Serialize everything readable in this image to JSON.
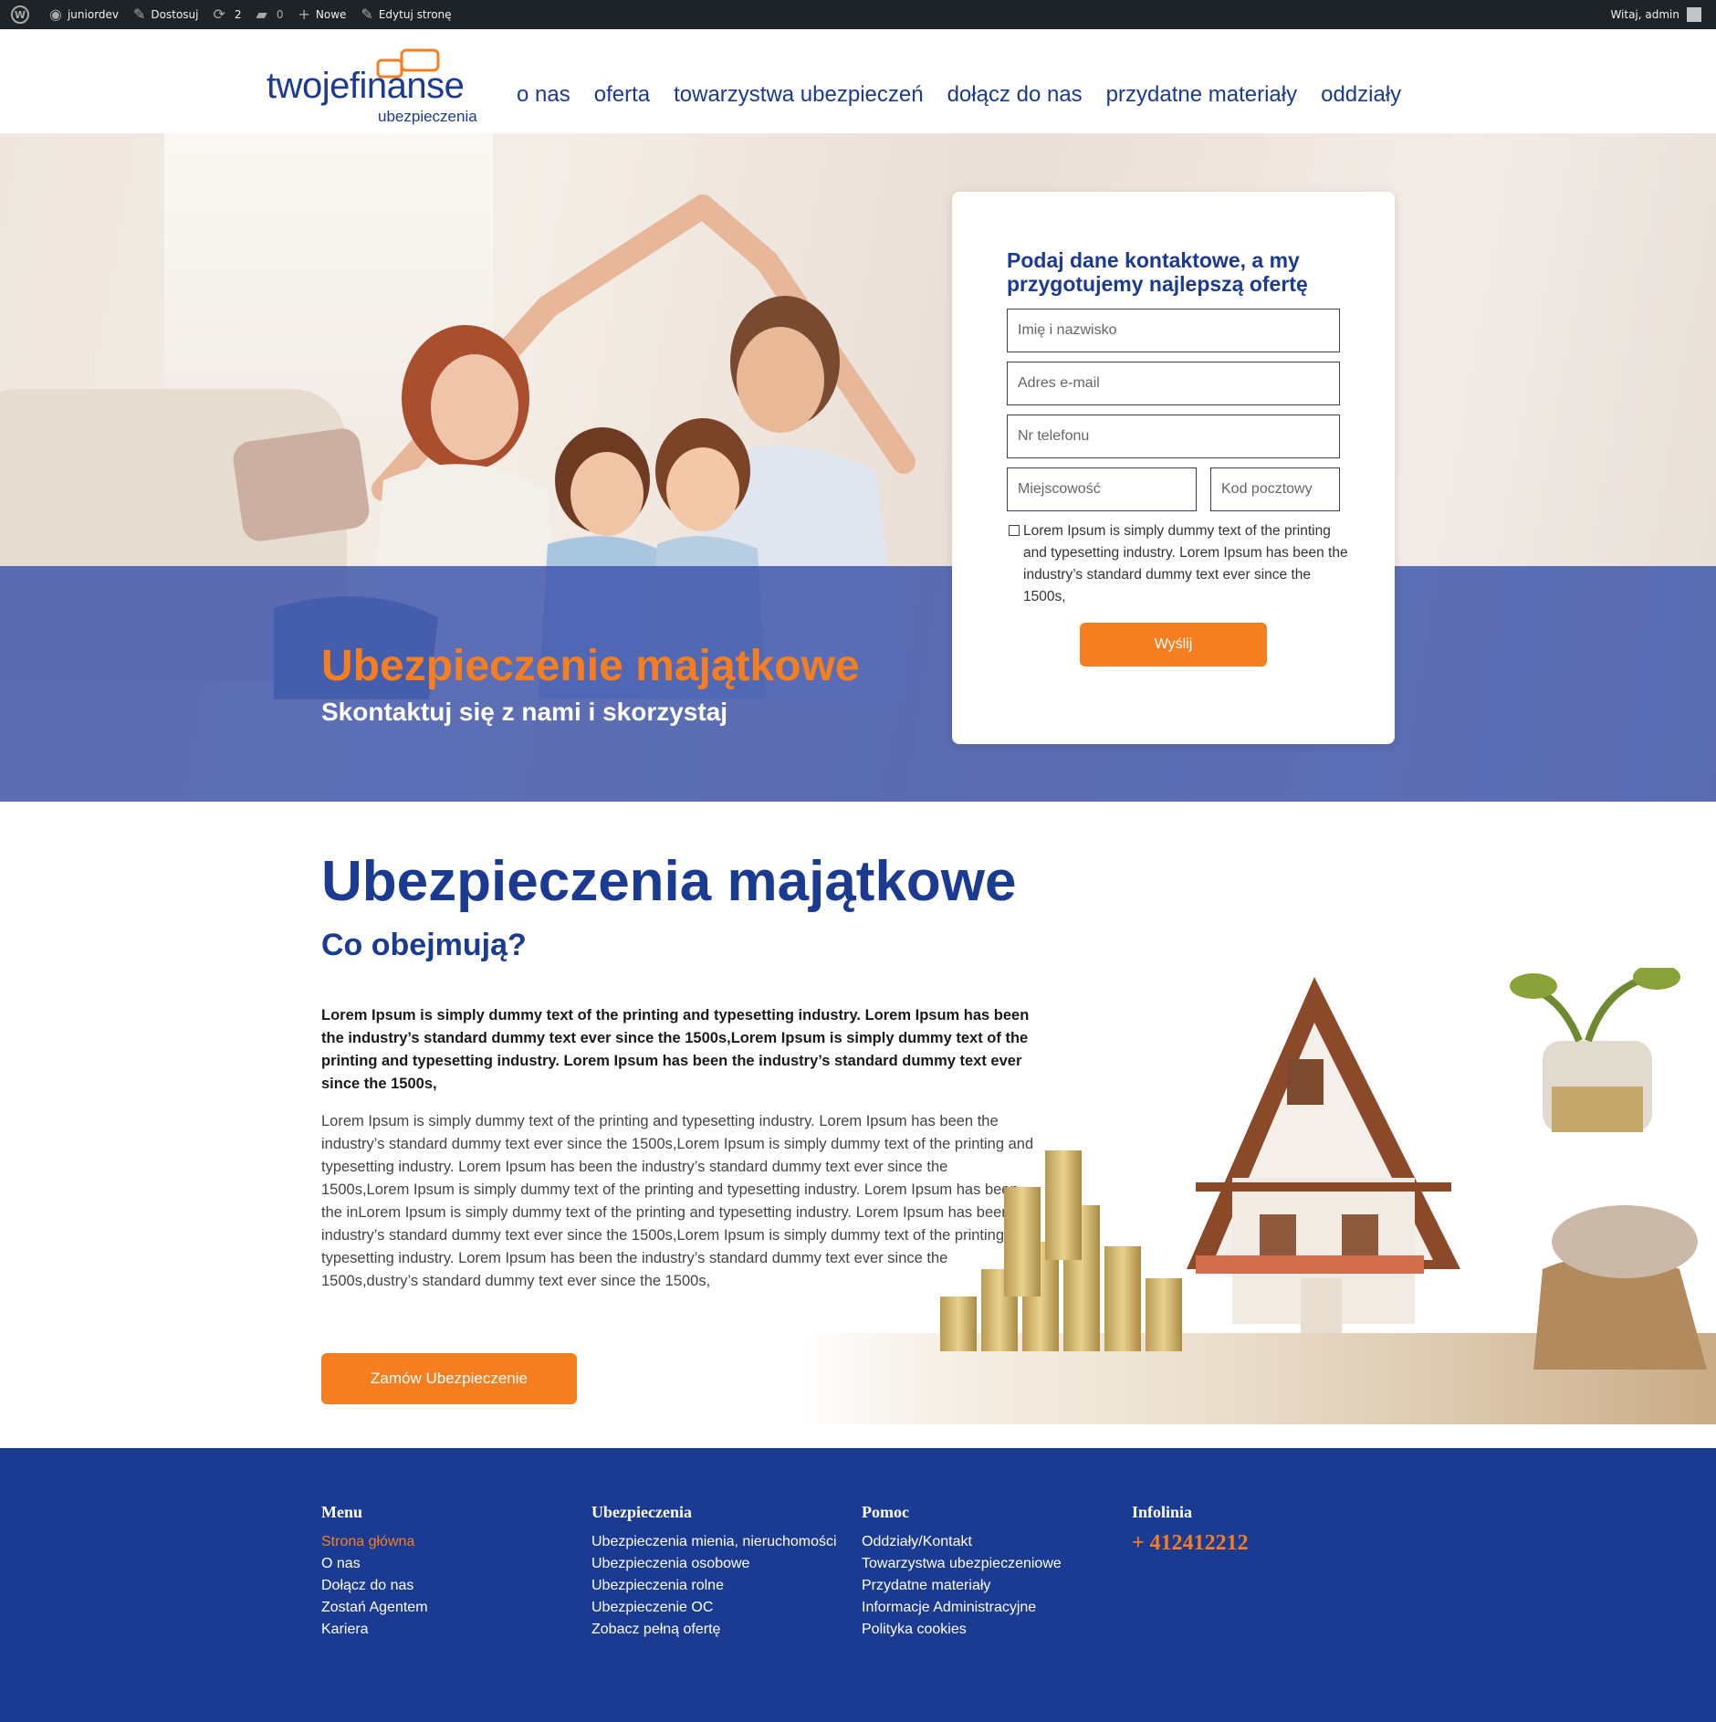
{
  "adminbar": {
    "site": "juniordev",
    "customize": "Dostosuj",
    "updates_count": "2",
    "comments_count": "0",
    "new": "Nowe",
    "edit": "Edytuj stronę",
    "greeting": "Witaj, admin"
  },
  "header": {
    "logo_main": "twojefinanse",
    "logo_sub": "ubezpieczenia",
    "nav": [
      "o nas",
      "oferta",
      "towarzystwa ubezpieczeń",
      "dołącz do nas",
      "przydatne materiały",
      "oddziały"
    ]
  },
  "hero": {
    "title": "Ubezpieczenie majątkowe",
    "subtitle": "Skontaktuj się z nami i skorzystaj"
  },
  "form": {
    "title": "Podaj dane kontaktowe, a my przygotujemy najlepszą ofertę",
    "name_placeholder": "Imię i nazwisko",
    "email_placeholder": "Adres e-mail",
    "phone_placeholder": "Nr telefonu",
    "city_placeholder": "Miejscowość",
    "zip_placeholder": "Kod pocztowy",
    "consent": "Lorem Ipsum is simply dummy text of the printing and typesetting industry. Lorem Ipsum has been the industry’s standard dummy text ever since the 1500s,",
    "submit": "Wyślij"
  },
  "content": {
    "title": "Ubezpieczenia majątkowe",
    "subtitle": "Co obejmują?",
    "lead": "Lorem Ipsum is simply dummy text of the printing and typesetting industry. Lorem Ipsum has been the industry’s standard dummy text ever since the 1500s,Lorem Ipsum is simply dummy text of the printing and typesetting industry. Lorem Ipsum has been the industry’s standard dummy text ever since the 1500s,",
    "body": "Lorem Ipsum is simply dummy text of the printing and typesetting industry. Lorem Ipsum has been the industry’s standard dummy text ever since the 1500s,Lorem Ipsum is simply dummy text of the printing and typesetting industry. Lorem Ipsum has been the industry’s standard dummy text ever since the 1500s,Lorem Ipsum is simply dummy text of the printing and typesetting industry. Lorem Ipsum has been the inLorem Ipsum is simply dummy text of the printing and typesetting industry. Lorem Ipsum has been the industry’s standard dummy text ever since the 1500s,Lorem Ipsum is simply dummy text of the printing and typesetting industry. Lorem Ipsum has been the industry’s standard dummy text ever since the 1500s,dustry’s standard dummy text ever since the 1500s,",
    "cta": "Zamów Ubezpieczenie"
  },
  "footer": {
    "menu": {
      "heading": "Menu",
      "links": [
        "Strona główna",
        "O nas",
        "Dołącz do nas",
        "Zostań Agentem",
        "Kariera"
      ]
    },
    "insurance": {
      "heading": "Ubezpieczenia",
      "links": [
        "Ubezpieczenia mienia, nieruchomości",
        "Ubezpieczenia osobowe",
        "Ubezpieczenia rolne",
        "Ubezpieczenie OC",
        "Zobacz pełną ofertę"
      ]
    },
    "help": {
      "heading": "Pomoc",
      "links": [
        "Oddziały/Kontakt",
        "Towarzystwa ubezpieczeniowe",
        "Przydatne materiały",
        "Informacje Administracyjne",
        "Polityka cookies"
      ]
    },
    "hotline": {
      "heading": "Infolinia",
      "phone": "+ 412412212"
    }
  },
  "colors": {
    "brand_blue": "#1b3a92",
    "accent_orange": "#f57f20",
    "admin_bar": "#1d2327"
  }
}
